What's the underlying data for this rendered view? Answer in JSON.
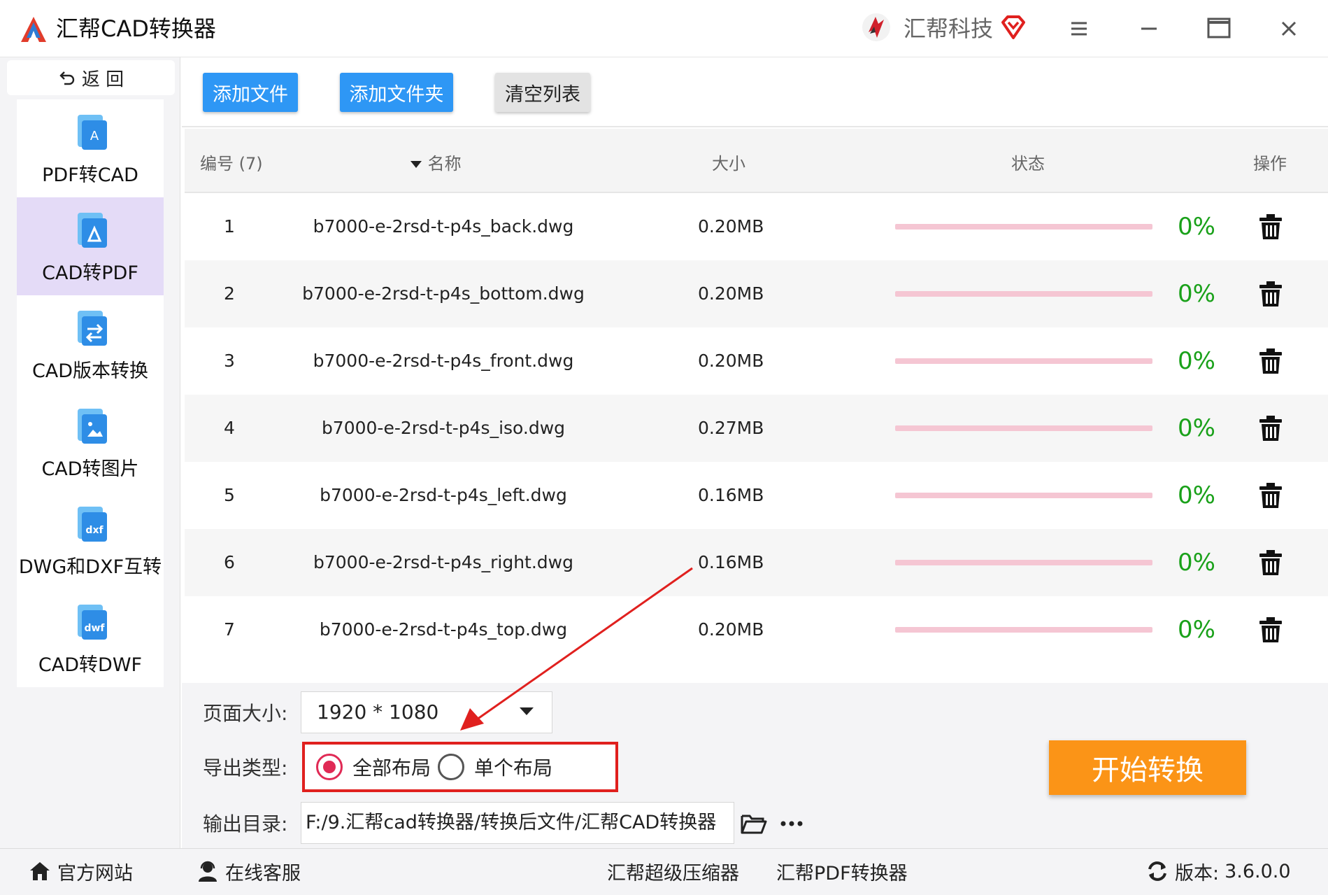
{
  "app": {
    "title": "汇帮CAD转换器",
    "brand": "汇帮科技",
    "accent": "#2e97f5"
  },
  "window_controls": [
    "menu-icon",
    "minimize-icon",
    "maximize-icon",
    "close-icon"
  ],
  "sidebar": {
    "back_label": "返 回",
    "items": [
      {
        "label": "PDF转CAD",
        "icon": "pdf-to-cad-icon",
        "active": false
      },
      {
        "label": "CAD转PDF",
        "icon": "cad-to-pdf-icon",
        "active": true
      },
      {
        "label": "CAD版本转换",
        "icon": "cad-version-icon",
        "active": false
      },
      {
        "label": "CAD转图片",
        "icon": "cad-to-image-icon",
        "active": false
      },
      {
        "label": "DWG和DXF互转",
        "icon": "dwg-dxf-icon",
        "active": false
      },
      {
        "label": "CAD转DWF",
        "icon": "cad-to-dwf-icon",
        "active": false
      }
    ]
  },
  "toolbar": {
    "add_file": "添加文件",
    "add_folder": "添加文件夹",
    "clear_list": "清空列表"
  },
  "table": {
    "headers": {
      "index": "编号 (7)",
      "name": "名称",
      "size": "大小",
      "status": "状态",
      "action": "操作"
    },
    "rows": [
      {
        "index": "1",
        "name": "b7000-e-2rsd-t-p4s_back.dwg",
        "size": "0.20MB",
        "progress": "0%",
        "progress_value": 0
      },
      {
        "index": "2",
        "name": "b7000-e-2rsd-t-p4s_bottom.dwg",
        "size": "0.20MB",
        "progress": "0%",
        "progress_value": 0
      },
      {
        "index": "3",
        "name": "b7000-e-2rsd-t-p4s_front.dwg",
        "size": "0.20MB",
        "progress": "0%",
        "progress_value": 0
      },
      {
        "index": "4",
        "name": "b7000-e-2rsd-t-p4s_iso.dwg",
        "size": "0.27MB",
        "progress": "0%",
        "progress_value": 0
      },
      {
        "index": "5",
        "name": "b7000-e-2rsd-t-p4s_left.dwg",
        "size": "0.16MB",
        "progress": "0%",
        "progress_value": 0
      },
      {
        "index": "6",
        "name": "b7000-e-2rsd-t-p4s_right.dwg",
        "size": "0.16MB",
        "progress": "0%",
        "progress_value": 0
      },
      {
        "index": "7",
        "name": "b7000-e-2rsd-t-p4s_top.dwg",
        "size": "0.20MB",
        "progress": "0%",
        "progress_value": 0
      }
    ]
  },
  "settings": {
    "page_size_label": "页面大小:",
    "page_size_value": "1920 * 1080",
    "export_type_label": "导出类型:",
    "export_options": [
      {
        "label": "全部布局",
        "selected": true
      },
      {
        "label": "单个布局",
        "selected": false
      }
    ],
    "output_dir_label": "输出目录:",
    "output_dir_value": "F:/9.汇帮cad转换器/转换后文件/汇帮CAD转换器",
    "start_button": "开始转换",
    "start_color": "#fb9417",
    "highlight_color": "#e0201e"
  },
  "footer": {
    "website": "官方网站",
    "support": "在线客服",
    "compressor": "汇帮超级压缩器",
    "pdf_converter": "汇帮PDF转换器",
    "version_label": "版本:",
    "version_value": "3.6.0.0"
  }
}
